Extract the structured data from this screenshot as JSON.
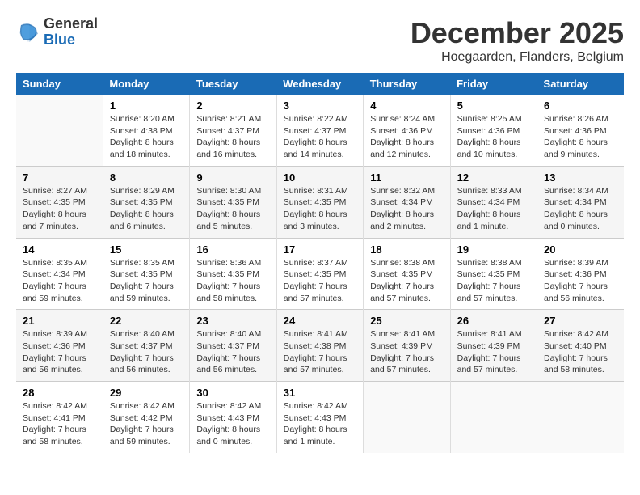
{
  "header": {
    "logo_line1": "General",
    "logo_line2": "Blue",
    "month": "December 2025",
    "location": "Hoegaarden, Flanders, Belgium"
  },
  "weekdays": [
    "Sunday",
    "Monday",
    "Tuesday",
    "Wednesday",
    "Thursday",
    "Friday",
    "Saturday"
  ],
  "weeks": [
    [
      {
        "day": "",
        "info": ""
      },
      {
        "day": "1",
        "info": "Sunrise: 8:20 AM\nSunset: 4:38 PM\nDaylight: 8 hours\nand 18 minutes."
      },
      {
        "day": "2",
        "info": "Sunrise: 8:21 AM\nSunset: 4:37 PM\nDaylight: 8 hours\nand 16 minutes."
      },
      {
        "day": "3",
        "info": "Sunrise: 8:22 AM\nSunset: 4:37 PM\nDaylight: 8 hours\nand 14 minutes."
      },
      {
        "day": "4",
        "info": "Sunrise: 8:24 AM\nSunset: 4:36 PM\nDaylight: 8 hours\nand 12 minutes."
      },
      {
        "day": "5",
        "info": "Sunrise: 8:25 AM\nSunset: 4:36 PM\nDaylight: 8 hours\nand 10 minutes."
      },
      {
        "day": "6",
        "info": "Sunrise: 8:26 AM\nSunset: 4:36 PM\nDaylight: 8 hours\nand 9 minutes."
      }
    ],
    [
      {
        "day": "7",
        "info": "Sunrise: 8:27 AM\nSunset: 4:35 PM\nDaylight: 8 hours\nand 7 minutes."
      },
      {
        "day": "8",
        "info": "Sunrise: 8:29 AM\nSunset: 4:35 PM\nDaylight: 8 hours\nand 6 minutes."
      },
      {
        "day": "9",
        "info": "Sunrise: 8:30 AM\nSunset: 4:35 PM\nDaylight: 8 hours\nand 5 minutes."
      },
      {
        "day": "10",
        "info": "Sunrise: 8:31 AM\nSunset: 4:35 PM\nDaylight: 8 hours\nand 3 minutes."
      },
      {
        "day": "11",
        "info": "Sunrise: 8:32 AM\nSunset: 4:34 PM\nDaylight: 8 hours\nand 2 minutes."
      },
      {
        "day": "12",
        "info": "Sunrise: 8:33 AM\nSunset: 4:34 PM\nDaylight: 8 hours\nand 1 minute."
      },
      {
        "day": "13",
        "info": "Sunrise: 8:34 AM\nSunset: 4:34 PM\nDaylight: 8 hours\nand 0 minutes."
      }
    ],
    [
      {
        "day": "14",
        "info": "Sunrise: 8:35 AM\nSunset: 4:34 PM\nDaylight: 7 hours\nand 59 minutes."
      },
      {
        "day": "15",
        "info": "Sunrise: 8:35 AM\nSunset: 4:35 PM\nDaylight: 7 hours\nand 59 minutes."
      },
      {
        "day": "16",
        "info": "Sunrise: 8:36 AM\nSunset: 4:35 PM\nDaylight: 7 hours\nand 58 minutes."
      },
      {
        "day": "17",
        "info": "Sunrise: 8:37 AM\nSunset: 4:35 PM\nDaylight: 7 hours\nand 57 minutes."
      },
      {
        "day": "18",
        "info": "Sunrise: 8:38 AM\nSunset: 4:35 PM\nDaylight: 7 hours\nand 57 minutes."
      },
      {
        "day": "19",
        "info": "Sunrise: 8:38 AM\nSunset: 4:35 PM\nDaylight: 7 hours\nand 57 minutes."
      },
      {
        "day": "20",
        "info": "Sunrise: 8:39 AM\nSunset: 4:36 PM\nDaylight: 7 hours\nand 56 minutes."
      }
    ],
    [
      {
        "day": "21",
        "info": "Sunrise: 8:39 AM\nSunset: 4:36 PM\nDaylight: 7 hours\nand 56 minutes."
      },
      {
        "day": "22",
        "info": "Sunrise: 8:40 AM\nSunset: 4:37 PM\nDaylight: 7 hours\nand 56 minutes."
      },
      {
        "day": "23",
        "info": "Sunrise: 8:40 AM\nSunset: 4:37 PM\nDaylight: 7 hours\nand 56 minutes."
      },
      {
        "day": "24",
        "info": "Sunrise: 8:41 AM\nSunset: 4:38 PM\nDaylight: 7 hours\nand 57 minutes."
      },
      {
        "day": "25",
        "info": "Sunrise: 8:41 AM\nSunset: 4:39 PM\nDaylight: 7 hours\nand 57 minutes."
      },
      {
        "day": "26",
        "info": "Sunrise: 8:41 AM\nSunset: 4:39 PM\nDaylight: 7 hours\nand 57 minutes."
      },
      {
        "day": "27",
        "info": "Sunrise: 8:42 AM\nSunset: 4:40 PM\nDaylight: 7 hours\nand 58 minutes."
      }
    ],
    [
      {
        "day": "28",
        "info": "Sunrise: 8:42 AM\nSunset: 4:41 PM\nDaylight: 7 hours\nand 58 minutes."
      },
      {
        "day": "29",
        "info": "Sunrise: 8:42 AM\nSunset: 4:42 PM\nDaylight: 7 hours\nand 59 minutes."
      },
      {
        "day": "30",
        "info": "Sunrise: 8:42 AM\nSunset: 4:43 PM\nDaylight: 8 hours\nand 0 minutes."
      },
      {
        "day": "31",
        "info": "Sunrise: 8:42 AM\nSunset: 4:43 PM\nDaylight: 8 hours\nand 1 minute."
      },
      {
        "day": "",
        "info": ""
      },
      {
        "day": "",
        "info": ""
      },
      {
        "day": "",
        "info": ""
      }
    ]
  ]
}
